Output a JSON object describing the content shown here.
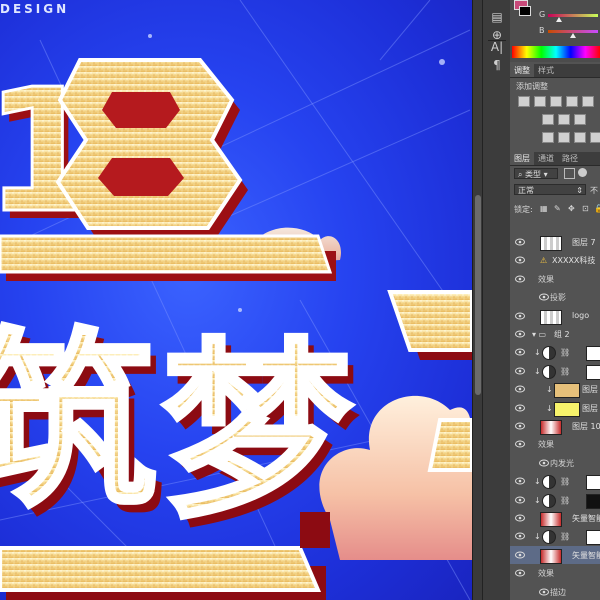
{
  "canvas": {
    "brand_text": "DESIGN",
    "poster_number": "18",
    "poster_title_chars": [
      "筑",
      "梦",
      "一"
    ]
  },
  "panel": {
    "color_tab": {
      "labels": {
        "g": "G",
        "b": "B"
      },
      "fg_color": "#c84b7a",
      "bg_color": "#000000"
    },
    "adjust_tabs": [
      {
        "label": "调整",
        "active": true
      },
      {
        "label": "样式",
        "active": false
      }
    ],
    "adjust_heading": "添加调整",
    "layers_tabs": [
      {
        "label": "图层",
        "active": true
      },
      {
        "label": "通道",
        "active": false
      },
      {
        "label": "路径",
        "active": false
      }
    ],
    "filter_dropdown": "类型",
    "blend_mode": "正常",
    "opacity_label": "不",
    "lock_label": "锁定:",
    "layers": [
      {
        "name": "图层 7",
        "kind": "pixel"
      },
      {
        "name": "XXXXX科技",
        "kind": "text"
      },
      {
        "name": "效果",
        "kind": "fx-header"
      },
      {
        "name": "投影",
        "kind": "fx-item"
      },
      {
        "name": "logo",
        "kind": "pixel"
      },
      {
        "name": "组 2",
        "kind": "group"
      },
      {
        "name": "",
        "kind": "adjust"
      },
      {
        "name": "",
        "kind": "adjust"
      },
      {
        "name": "图层",
        "kind": "clip-gold"
      },
      {
        "name": "图层",
        "kind": "clip-yellow"
      },
      {
        "name": "图层 10",
        "kind": "pixel-fx"
      },
      {
        "name": "效果",
        "kind": "fx-header"
      },
      {
        "name": "内发光",
        "kind": "fx-item"
      },
      {
        "name": "",
        "kind": "clip-adjust"
      },
      {
        "name": "",
        "kind": "clip-adjust-dark"
      },
      {
        "name": "矢量智能",
        "kind": "smart"
      },
      {
        "name": "",
        "kind": "clip-adjust"
      },
      {
        "name": "矢量智能",
        "kind": "smart-selected"
      },
      {
        "name": "效果",
        "kind": "fx-header"
      },
      {
        "name": "描边",
        "kind": "fx-item"
      }
    ]
  }
}
